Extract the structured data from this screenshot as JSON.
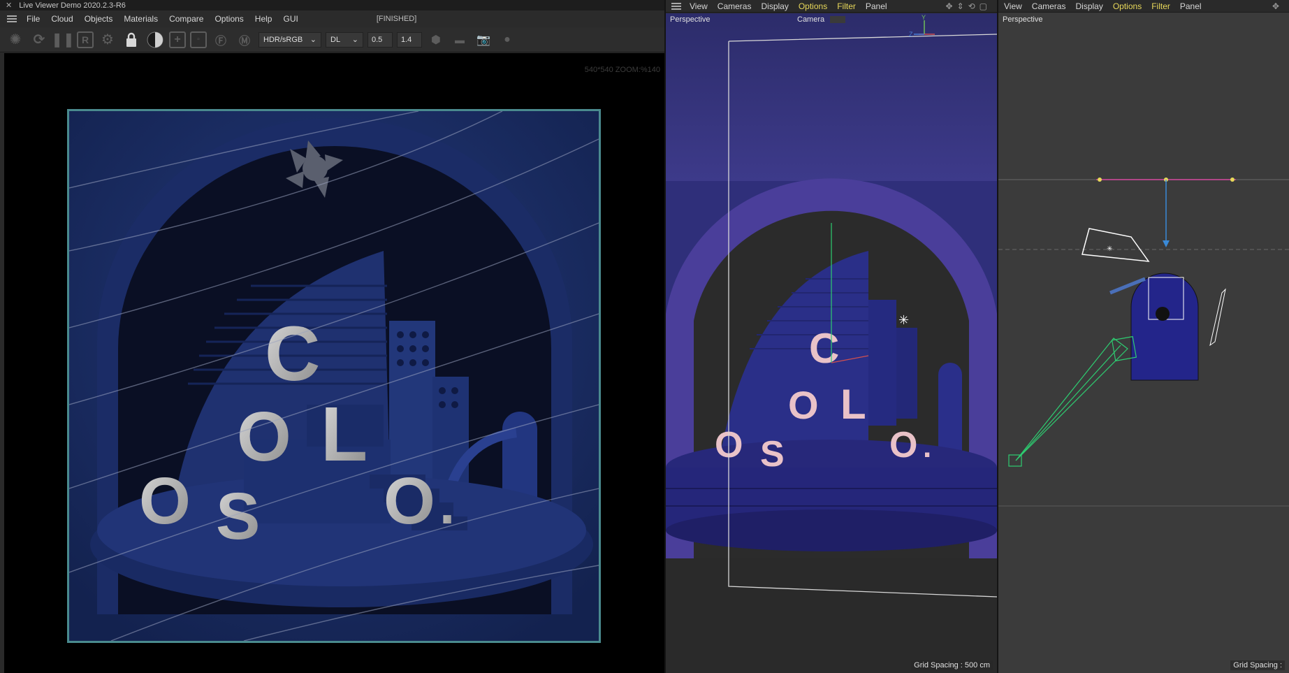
{
  "app": {
    "title": "Live Viewer Demo 2020.2.3-R6",
    "menu": [
      "File",
      "Cloud",
      "Objects",
      "Materials",
      "Compare",
      "Options",
      "Help",
      "GUI"
    ],
    "status": "[FINISHED]",
    "toolbar": {
      "color_space": "HDR/sRGB",
      "kernel": "DL",
      "value_a": "0.5",
      "value_b": "1.4"
    },
    "zoom_info": "540*540 ZOOM:%140"
  },
  "render_letters": [
    "C",
    "O",
    "L",
    "O",
    "S",
    "O",
    "."
  ],
  "viewport_center": {
    "menu": [
      "View",
      "Cameras",
      "Display",
      "Options",
      "Filter",
      "Panel"
    ],
    "highlighted": [
      "Options",
      "Filter"
    ],
    "label": "Perspective",
    "camera_label": "Camera",
    "grid_spacing": "Grid Spacing : 500 cm",
    "axis_y": "Y",
    "axis_z": "Z"
  },
  "viewport_right": {
    "menu": [
      "View",
      "Cameras",
      "Display",
      "Options",
      "Filter",
      "Panel"
    ],
    "highlighted": [
      "Options",
      "Filter"
    ],
    "label": "Perspective",
    "grid_spacing": "Grid Spacing :"
  },
  "colors": {
    "scene_blue": "#1d2d63",
    "frame_teal": "#4a8a8e",
    "highlight_yellow": "#e8d85a",
    "wire_green": "#2ecc71"
  }
}
